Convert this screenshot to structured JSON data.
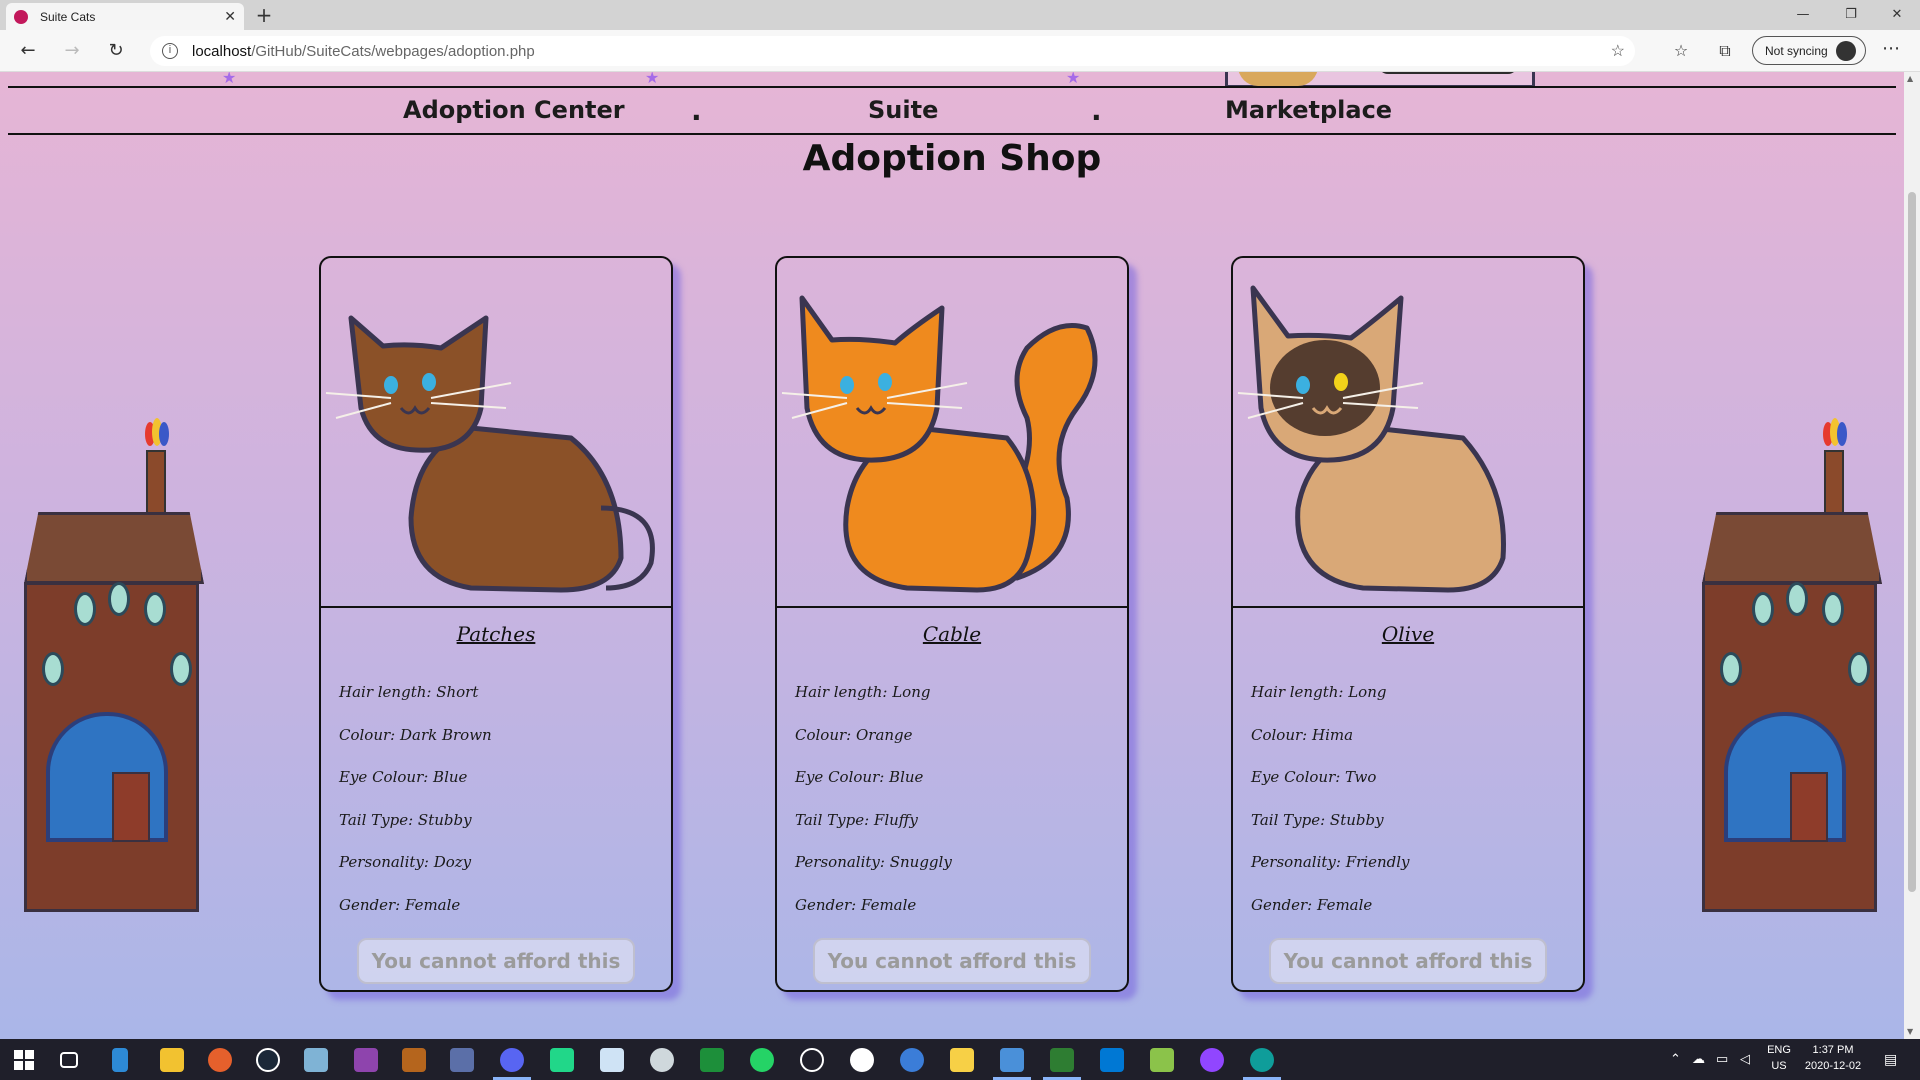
{
  "browser": {
    "tab_title": "Suite Cats",
    "tab_close": "✕",
    "new_tab": "+",
    "url_host": "localhost",
    "url_path": "/GitHub/SuiteCats/webpages/adoption.php",
    "sync_label": "Not syncing",
    "window_controls": {
      "minimize": "—",
      "restore": "❐",
      "close": "✕"
    }
  },
  "nav": {
    "items": [
      "Adoption Center",
      "Suite",
      "Marketplace"
    ],
    "separator": "."
  },
  "page": {
    "title": "Adoption Shop"
  },
  "cats": [
    {
      "name": "Patches",
      "fur_color": "#8b5128",
      "eye_color": "#3bb0e0",
      "attributes": [
        "Hair length: Short",
        "Colour: Dark Brown",
        "Eye Colour: Blue",
        "Tail Type: Stubby",
        "Personality: Dozy",
        "Gender: Female"
      ],
      "button": "You cannot afford this cat."
    },
    {
      "name": "Cable",
      "fur_color": "#ef8a1e",
      "eye_color": "#3bb0e0",
      "attributes": [
        "Hair length: Long",
        "Colour: Orange",
        "Eye Colour: Blue",
        "Tail Type: Fluffy",
        "Personality: Snuggly",
        "Gender: Female"
      ],
      "button": "You cannot afford this cat."
    },
    {
      "name": "Olive",
      "fur_color": "#d9a877",
      "eye_color": "#3bb0e0",
      "attributes": [
        "Hair length: Long",
        "Colour: Hima",
        "Eye Colour: Two",
        "Tail Type: Stubby",
        "Personality: Friendly",
        "Gender: Female"
      ],
      "button": "You cannot afford this cat."
    }
  ],
  "taskbar": {
    "language": "ENG",
    "region": "US",
    "time": "1:37 PM",
    "date": "2020-12-02"
  },
  "colors": {
    "page_gradient_top": "#e6b5d5",
    "page_gradient_bottom": "#aab6e8",
    "card_shadow": "#7864dc"
  }
}
